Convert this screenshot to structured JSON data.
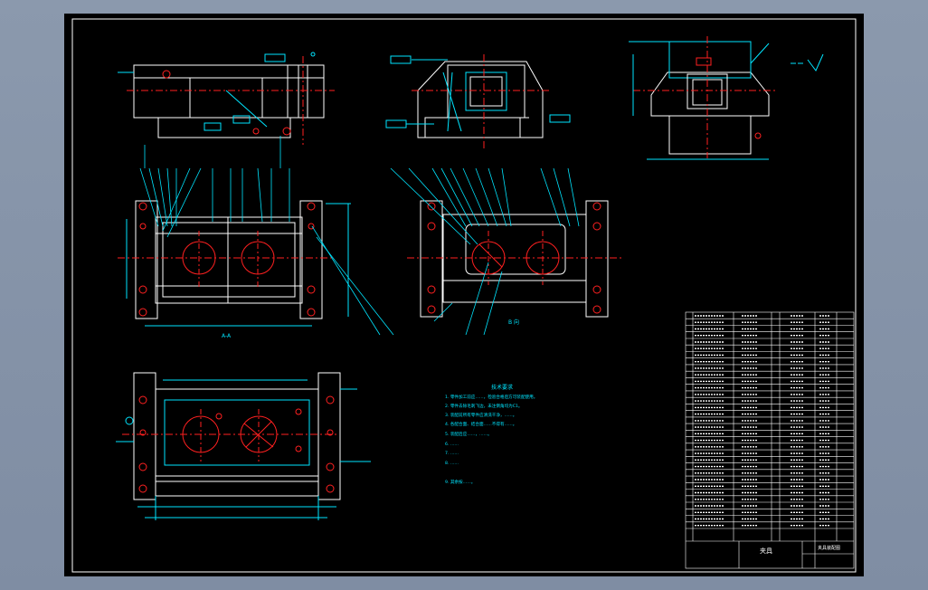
{
  "drawing": {
    "background_color": "#000000",
    "frame_color": "#ffffff",
    "part_outline_color": "#ffffff",
    "hole_color": "#ff2020",
    "centerline_color": "#ff2020",
    "dimension_color": "#00e5ff",
    "leader_color": "#00e5ff",
    "section_label": "A-A",
    "view_label": "B 向",
    "tech_req_title": "技术要求",
    "tech_req_lines": [
      "1. 零件加工前应……，检验合格后方可装配使用。",
      "2. 零件去除毛刺飞边，未注倒角均为C1。",
      "3. 装配前所有零件应清洗干净，……。",
      "4. 各配合面、结合面……不得有……。",
      "5. 装配后应……，……。",
      "6. ……",
      "7. ……",
      "8. ……",
      "9. 其余按……。"
    ],
    "title_block_name": "夹具",
    "title_block_material": "夹具装配图"
  }
}
